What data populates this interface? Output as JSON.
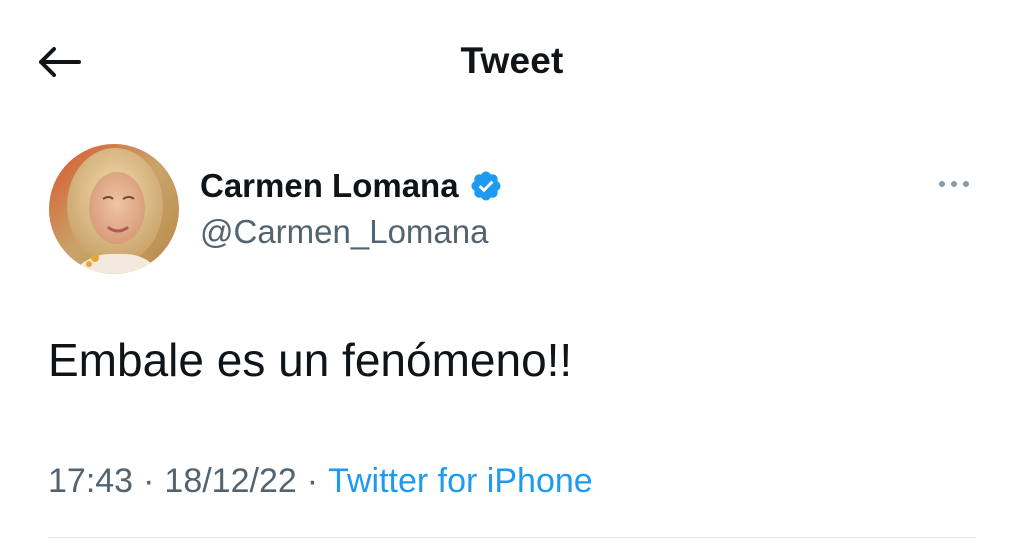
{
  "header": {
    "title": "Tweet",
    "back_icon": "arrow-left-icon"
  },
  "author": {
    "display_name": "Carmen Lomana",
    "handle": "@Carmen_Lomana",
    "verified_icon": "verified-badge-icon",
    "avatar": "profile-photo"
  },
  "tweet": {
    "text": "Embale es un fenómeno!!",
    "time": "17:43",
    "date": "18/12/22",
    "separator": "·",
    "source": "Twitter for iPhone"
  },
  "menu": {
    "icon": "more-options-icon"
  },
  "colors": {
    "text_primary": "#0f1419",
    "text_secondary": "#536471",
    "accent": "#1d9bf0",
    "divider": "#e1e6ea"
  }
}
